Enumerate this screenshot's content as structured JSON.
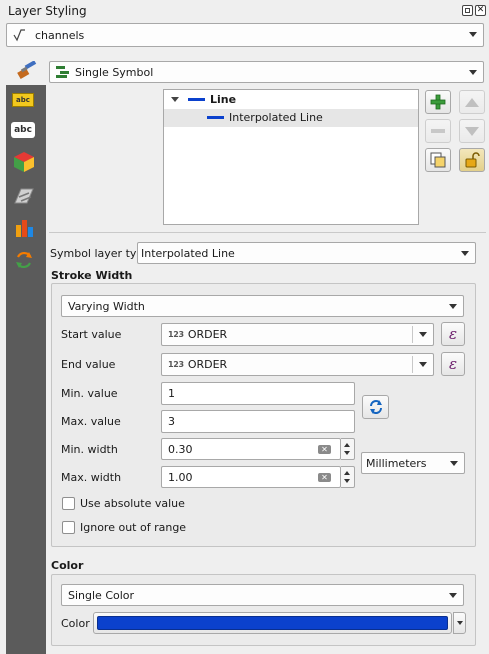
{
  "panel": {
    "title": "Layer Styling"
  },
  "layer": {
    "name": "channels"
  },
  "renderer": {
    "label": "Single Symbol"
  },
  "tree": {
    "root": "Line",
    "child": "Interpolated Line"
  },
  "symbol_layer": {
    "type_label": "Symbol layer type",
    "type_value": "Interpolated Line"
  },
  "stroke": {
    "heading": "Stroke Width",
    "mode": "Varying Width",
    "start_label": "Start value",
    "start_field_type": "123",
    "start_field": "ORDER",
    "end_label": "End value",
    "end_field_type": "123",
    "end_field": "ORDER",
    "min_value_label": "Min. value",
    "min_value": "1",
    "max_value_label": "Max. value",
    "max_value": "3",
    "min_width_label": "Min. width",
    "min_width": "0.30",
    "max_width_label": "Max. width",
    "max_width": "1.00",
    "unit": "Millimeters",
    "use_absolute_label": "Use absolute value",
    "ignore_range_label": "Ignore out of range"
  },
  "color": {
    "heading": "Color",
    "mode": "Single Color",
    "label": "Color",
    "value": "#0b41cd"
  },
  "icons": {
    "expression": "ε",
    "clear": "✕"
  }
}
